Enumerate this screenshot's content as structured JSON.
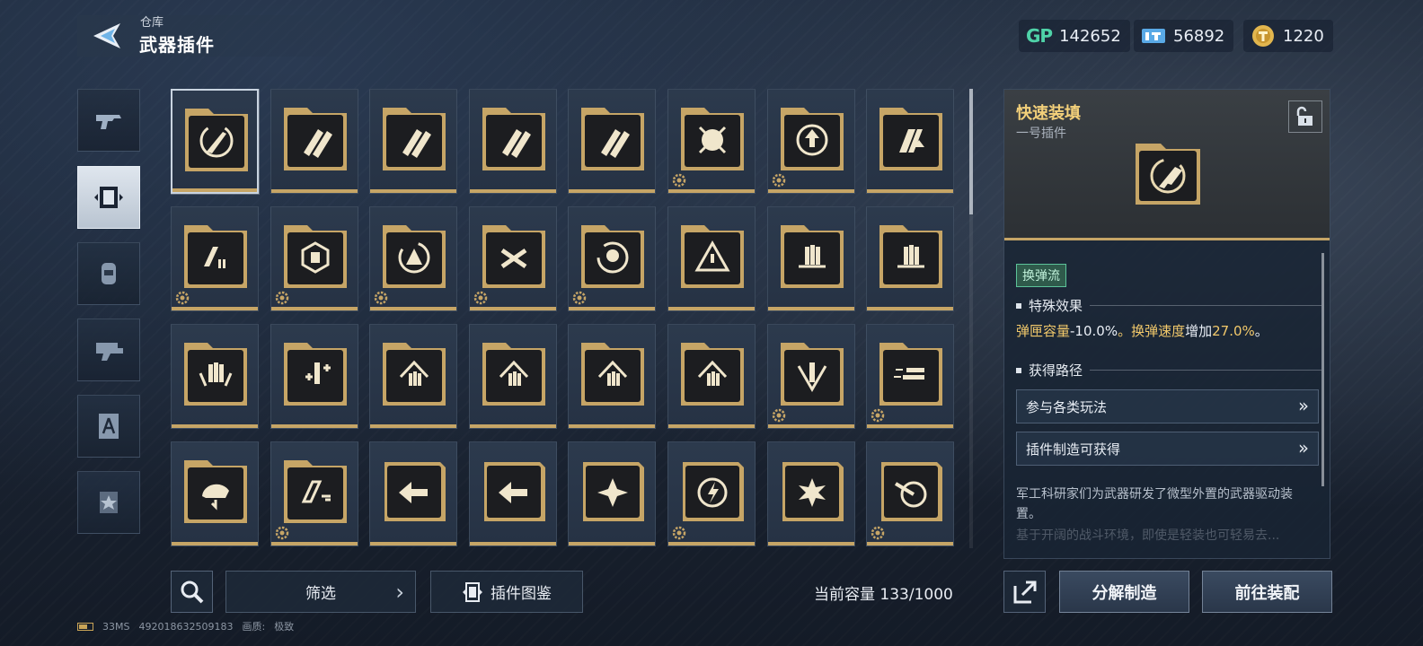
{
  "header": {
    "breadcrumb": "仓库",
    "title": "武器插件"
  },
  "currencies": [
    {
      "icon": "gp-icon",
      "label": "GP",
      "value": "142652"
    },
    {
      "icon": "ticket-icon",
      "value": "56892"
    },
    {
      "icon": "coin-icon",
      "value": "1220"
    }
  ],
  "nav": [
    "pistol-icon",
    "plugin-card-icon",
    "capsule-icon",
    "gun-part-icon",
    "compass-card-icon",
    "star-card-icon"
  ],
  "grid": {
    "rows": [
      [
        {
          "icon": "rocket-reload",
          "gear": false,
          "selected": true
        },
        {
          "icon": "double-bullet"
        },
        {
          "icon": "double-bullet"
        },
        {
          "icon": "double-bullet"
        },
        {
          "icon": "double-bullet"
        },
        {
          "icon": "crosshair-burst",
          "gear": true
        },
        {
          "icon": "target-up",
          "gear": true
        },
        {
          "icon": "mag-up"
        }
      ],
      [
        {
          "icon": "mag-cells",
          "gear": true
        },
        {
          "icon": "hex-network",
          "gear": true
        },
        {
          "icon": "warning-cycle",
          "gear": true
        },
        {
          "icon": "crossed-rounds",
          "gear": true
        },
        {
          "icon": "skull-cycle",
          "gear": true
        },
        {
          "icon": "triangle-alert"
        },
        {
          "icon": "triple-round"
        },
        {
          "icon": "triple-round"
        }
      ],
      [
        {
          "icon": "triple-round-wings"
        },
        {
          "icon": "round-plus"
        },
        {
          "icon": "house-rounds"
        },
        {
          "icon": "house-rounds"
        },
        {
          "icon": "house-rounds"
        },
        {
          "icon": "house-rounds"
        },
        {
          "icon": "v-round",
          "gear": true
        },
        {
          "icon": "speed-rounds",
          "gear": true
        }
      ],
      [
        {
          "icon": "helmet-arrow"
        },
        {
          "icon": "mag-swap",
          "gear": true
        },
        {
          "icon": "arrow-dash",
          "gold": true
        },
        {
          "icon": "arrow-dash",
          "gold": true
        },
        {
          "icon": "star-frame",
          "gold": true
        },
        {
          "icon": "lightning-target",
          "gold": true,
          "gear": true
        },
        {
          "icon": "burst-round",
          "gold": true
        },
        {
          "icon": "dart-target",
          "gold": true,
          "gear": true
        }
      ]
    ]
  },
  "bottom": {
    "filter": "筛选",
    "catalog": "插件图鉴",
    "capacity": "当前容量 133/1000"
  },
  "detail": {
    "name": "快速装填",
    "subtitle": "一号插件",
    "tag": "换弹流",
    "effect_heading": "特殊效果",
    "effect_parts": [
      "弹匣容量",
      "-10.0%",
      "。",
      "换弹速度",
      "增加",
      "27.0%",
      "。"
    ],
    "route_heading": "获得路径",
    "routes": [
      "参与各类玩法",
      "插件制造可获得"
    ],
    "description": "军工科研家们为武器研发了微型外置的武器驱动装置。",
    "description_more": "基于开阔的战斗环境，即使是轻装也可轻易去..."
  },
  "actions": {
    "decompose": "分解制造",
    "equip": "前往装配"
  },
  "footer": {
    "ping": "33MS",
    "uid": "492018632509183",
    "quality_label": "画质:",
    "quality": "极致"
  },
  "colors": {
    "gold": "#c6a566",
    "title_gold": "#f3d07a",
    "tag_green": "#5cc39a",
    "gp_green": "#4fd2a8"
  }
}
